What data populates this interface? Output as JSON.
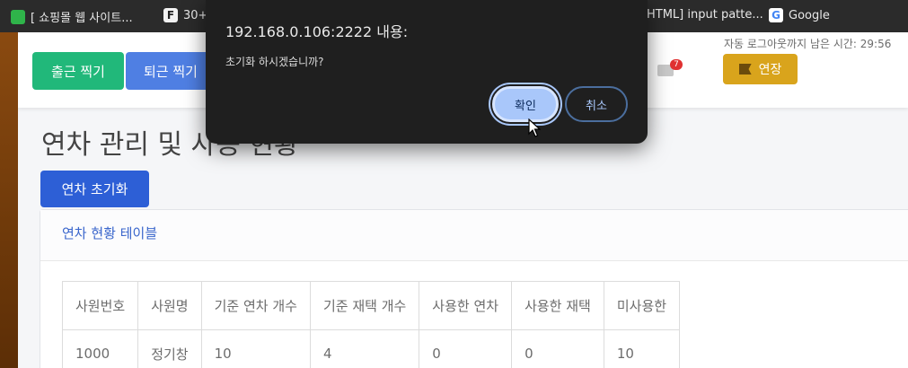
{
  "bookmarks": [
    {
      "icon": "naver-icon",
      "label": "[ 쇼핑몰 웹 사이트..."
    },
    {
      "icon": "f-icon",
      "label": "30+"
    },
    {
      "icon": "bookmark-icon",
      "label": "HTML] input patte..."
    },
    {
      "icon": "google-icon",
      "label": "Google"
    }
  ],
  "header": {
    "clock_in_label": "출근 찍기",
    "clock_out_label": "퇴근 찍기",
    "logout_timer": "자동 로그아웃까지 남은 시간: 29:56",
    "mail_count": "7",
    "field_label": "연장"
  },
  "main": {
    "page_title": "연차 관리 및 사용 현황",
    "reset_button": "연차 초기화",
    "card_title": "연차 현황 테이블",
    "table": {
      "headers": [
        "사원번호",
        "사원명",
        "기준 연차 개수",
        "기준 재택 개수",
        "사용한 연차",
        "사용한 재택",
        "미사용한"
      ],
      "rows": [
        [
          "1000",
          "정기창",
          "10",
          "4",
          "0",
          "0",
          "10"
        ]
      ]
    }
  },
  "dialog": {
    "title": "192.168.0.106:2222 내용:",
    "message": "초기화 하시겠습니까?",
    "ok_label": "확인",
    "cancel_label": "취소"
  },
  "colors": {
    "clock_in": "#21b87a",
    "clock_out": "#4f7fe3",
    "reset": "#2d5fd6",
    "field": "#d9a41c",
    "dialog_bg": "#1f1f1f",
    "dialog_ok": "#a9c7fa"
  }
}
